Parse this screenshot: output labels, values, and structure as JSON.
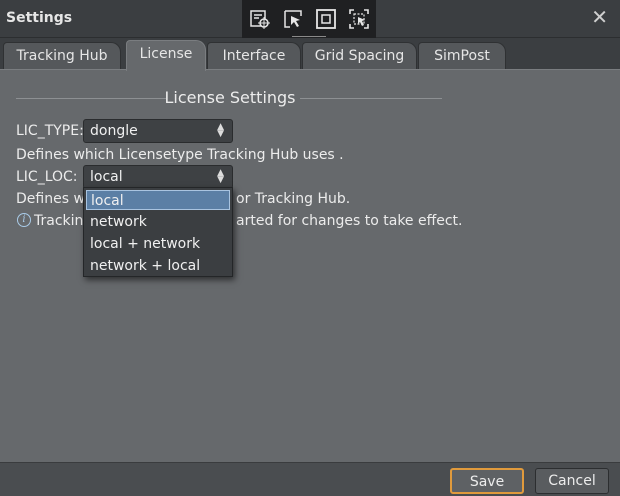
{
  "window": {
    "title": "Settings",
    "close_glyph": "✕"
  },
  "toolbar": {
    "icons": [
      "target-cursor-icon",
      "pointer-select-icon",
      "frame-select-icon",
      "region-select-icon"
    ]
  },
  "tabs": [
    {
      "label": "Tracking Hub",
      "active": false
    },
    {
      "label": "License",
      "active": true
    },
    {
      "label": "Interface",
      "active": false
    },
    {
      "label": "Grid Spacing",
      "active": false
    },
    {
      "label": "SimPost",
      "active": false
    }
  ],
  "section": {
    "title": "License Settings"
  },
  "lic_type": {
    "label": "LIC_TYPE:",
    "value": "dongle",
    "description": "Defines which Licensetype Tracking Hub uses ."
  },
  "lic_loc": {
    "label": "LIC_LOC:",
    "value": "local",
    "description_left": "Defines wh",
    "description_right": "or Tracking Hub.",
    "options": [
      "local",
      "network",
      "local + network",
      "network + local"
    ],
    "selected_index": 0
  },
  "info": {
    "text_left": "Trackin",
    "text_right": "arted for changes to take effect."
  },
  "footer": {
    "save_label": "Save",
    "cancel_label": "Cancel"
  },
  "colors": {
    "accent": "#e09a3c",
    "selection": "#5b7fa5",
    "info_icon": "#a9cbe8"
  }
}
